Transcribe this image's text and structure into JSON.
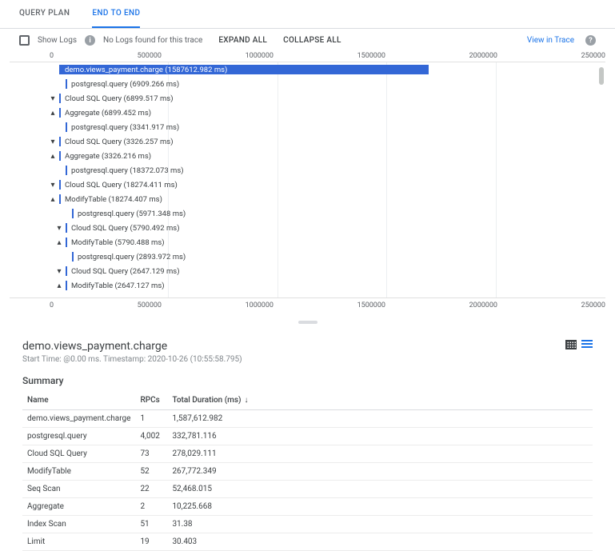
{
  "tabs": {
    "query_plan": "QUERY PLAN",
    "end_to_end": "END TO END"
  },
  "toolbar": {
    "show_logs": "Show Logs",
    "no_logs": "No Logs found for this trace",
    "expand_all": "EXPAND ALL",
    "collapse_all": "COLLAPSE ALL",
    "view_in_trace": "View in Trace"
  },
  "ruler": [
    "0",
    "500000",
    "1000000",
    "1500000",
    "2000000",
    "250000"
  ],
  "spans": [
    {
      "chev": "down",
      "indent": 0,
      "label": "demo.views_payment.charge (1587612.982 ms)",
      "bar": "wide",
      "barw": 62,
      "selected": true
    },
    {
      "chev": "",
      "indent": 1,
      "label": "postgresql.query (6909.266 ms)",
      "bar": "thin"
    },
    {
      "chev": "down",
      "indent": 0,
      "label": "Cloud SQL Query (6899.517 ms)",
      "bar": "thin"
    },
    {
      "chev": "up",
      "indent": 0,
      "label": "Aggregate (6899.452 ms)",
      "bar": "thin"
    },
    {
      "chev": "",
      "indent": 1,
      "label": "postgresql.query (3341.917 ms)",
      "bar": "thin"
    },
    {
      "chev": "down",
      "indent": 0,
      "label": "Cloud SQL Query (3326.257 ms)",
      "bar": "thin"
    },
    {
      "chev": "up",
      "indent": 0,
      "label": "Aggregate (3326.216 ms)",
      "bar": "thin"
    },
    {
      "chev": "",
      "indent": 1,
      "label": "postgresql.query (18372.073 ms)",
      "bar": "thin"
    },
    {
      "chev": "down",
      "indent": 0,
      "label": "Cloud SQL Query (18274.411 ms)",
      "bar": "thin"
    },
    {
      "chev": "up",
      "indent": 0,
      "label": "ModifyTable (18274.407 ms)",
      "bar": "thin"
    },
    {
      "chev": "",
      "indent": 2,
      "label": "postgresql.query (5971.348 ms)",
      "bar": "thin"
    },
    {
      "chev": "down",
      "indent": 1,
      "label": "Cloud SQL Query (5790.492 ms)",
      "bar": "thin"
    },
    {
      "chev": "up",
      "indent": 1,
      "label": "ModifyTable (5790.488 ms)",
      "bar": "thin"
    },
    {
      "chev": "",
      "indent": 2,
      "label": "postgresql.query (2893.972 ms)",
      "bar": "thin"
    },
    {
      "chev": "down",
      "indent": 1,
      "label": "Cloud SQL Query (2647.129 ms)",
      "bar": "thin"
    },
    {
      "chev": "up",
      "indent": 1,
      "label": "ModifyTable (2647.127 ms)",
      "bar": "thin"
    }
  ],
  "details": {
    "title": "demo.views_payment.charge",
    "subtitle": "Start Time: @0.00 ms. Timestamp: 2020-10-26 (10:55:58.795)",
    "summary_title": "Summary",
    "columns": {
      "name": "Name",
      "rpcs": "RPCs",
      "duration": "Total Duration (ms)"
    }
  },
  "summary_rows": [
    {
      "name": "demo.views_payment.charge",
      "rpcs": "1",
      "dur": "1,587,612.982"
    },
    {
      "name": "postgresql.query",
      "rpcs": "4,002",
      "dur": "332,781.116"
    },
    {
      "name": "Cloud SQL Query",
      "rpcs": "73",
      "dur": "278,029.111"
    },
    {
      "name": "ModifyTable",
      "rpcs": "52",
      "dur": "267,772.349"
    },
    {
      "name": "Seq Scan",
      "rpcs": "22",
      "dur": "52,468.015"
    },
    {
      "name": "Aggregate",
      "rpcs": "2",
      "dur": "10,225.668"
    },
    {
      "name": "Index Scan",
      "rpcs": "51",
      "dur": "31.38"
    },
    {
      "name": "Limit",
      "rpcs": "19",
      "dur": "30.403"
    }
  ]
}
